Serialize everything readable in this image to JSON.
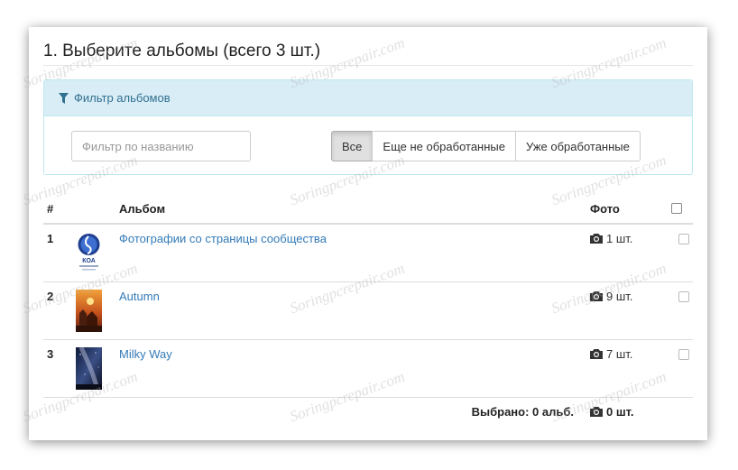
{
  "section": {
    "title": "1. Выберите альбомы (всего 3 шт.)"
  },
  "filter": {
    "header": "Фильтр альбомов",
    "name_placeholder": "Фильтр по названию",
    "buttons": [
      {
        "label": "Все",
        "active": true
      },
      {
        "label": "Еще не обработанные",
        "active": false
      },
      {
        "label": "Уже обработанные",
        "active": false
      }
    ]
  },
  "table": {
    "headers": {
      "num": "#",
      "album": "Альбом",
      "photos": "Фото"
    },
    "rows": [
      {
        "num": "1",
        "title": "Фотографии со страницы сообщества",
        "count": "1 шт.",
        "thumb": "logo-thumbnail"
      },
      {
        "num": "2",
        "title": "Autumn",
        "count": "9 шт.",
        "thumb": "autumn-thumbnail"
      },
      {
        "num": "3",
        "title": "Milky Way",
        "count": "7 шт.",
        "thumb": "milky-way-thumbnail"
      }
    ],
    "footer": {
      "selected": "Выбрано: 0 альб.",
      "photos": "0 шт."
    }
  },
  "watermark": "Soringpcrepair.com",
  "colors": {
    "link": "#337ab7",
    "panel_header_bg": "#d9edf7",
    "panel_border": "#bce8f1",
    "panel_text": "#31708f"
  }
}
